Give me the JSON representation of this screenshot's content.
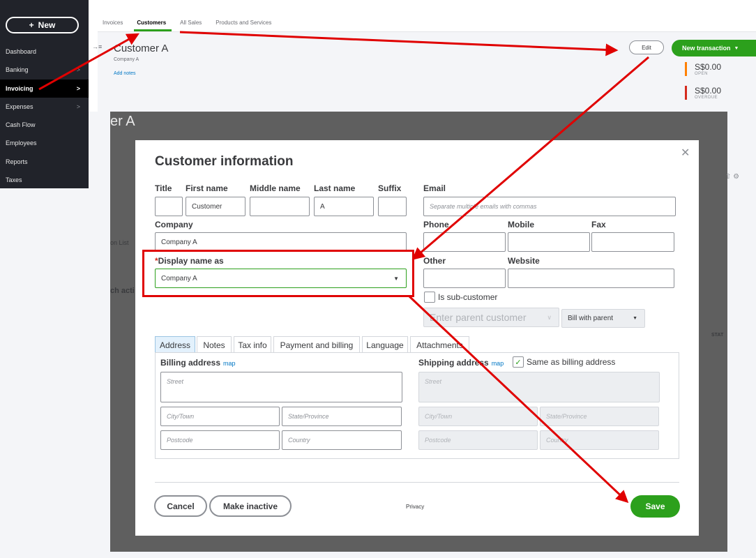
{
  "sidebar": {
    "new_label": "New",
    "items": [
      {
        "label": "Dashboard",
        "chev": ""
      },
      {
        "label": "Banking",
        "chev": ">"
      },
      {
        "label": "Invoicing",
        "chev": ">"
      },
      {
        "label": "Expenses",
        "chev": ">"
      },
      {
        "label": "Cash Flow",
        "chev": ""
      },
      {
        "label": "Employees",
        "chev": ""
      },
      {
        "label": "Reports",
        "chev": ""
      },
      {
        "label": "Taxes",
        "chev": ""
      }
    ],
    "active_item": "Invoicing"
  },
  "top_tabs": [
    "Invoices",
    "Customers",
    "All Sales",
    "Products and Services"
  ],
  "active_tab": "Customers",
  "customer_header": {
    "name": "Customer A",
    "company": "Company A",
    "add_notes": "Add notes",
    "edit_label": "Edit",
    "new_transaction_label": "New transaction",
    "open_amount": "S$0.00",
    "open_label": "OPEN",
    "overdue_amount": "S$0.00",
    "overdue_label": "OVERDUE"
  },
  "background_peek": {
    "title_fragment": "er A",
    "list_fragment": "on List",
    "action_fragment": "ch acti",
    "status_fragment": "STAT"
  },
  "dialog": {
    "title": "Customer information",
    "labels": {
      "title": "Title",
      "first_name": "First name",
      "middle_name": "Middle name",
      "last_name": "Last name",
      "suffix": "Suffix",
      "email": "Email",
      "company": "Company",
      "phone": "Phone",
      "mobile": "Mobile",
      "fax": "Fax",
      "display_name": "Display name as",
      "other": "Other",
      "website": "Website",
      "sub_customer": "Is sub-customer"
    },
    "values": {
      "title": "",
      "first_name": "Customer",
      "middle_name": "",
      "last_name": "A",
      "suffix": "",
      "company": "Company A",
      "display_name": "Company A"
    },
    "placeholders": {
      "email": "Separate multiple emails with commas",
      "parent_customer": "Enter parent customer",
      "bill_with_parent": "Bill with parent"
    },
    "tabs": [
      "Address",
      "Notes",
      "Tax info",
      "Payment and billing",
      "Language",
      "Attachments"
    ],
    "active_tab": "Address",
    "address": {
      "billing_label": "Billing address",
      "shipping_label": "Shipping address",
      "map_link": "map",
      "same_as_billing": "Same as billing address",
      "street": "Street",
      "city": "City/Town",
      "state": "State/Province",
      "postcode": "Postcode",
      "country": "Country"
    },
    "buttons": {
      "cancel": "Cancel",
      "make_inactive": "Make inactive",
      "privacy": "Privacy",
      "save": "Save"
    }
  },
  "annotation": {
    "color": "#e00000"
  }
}
